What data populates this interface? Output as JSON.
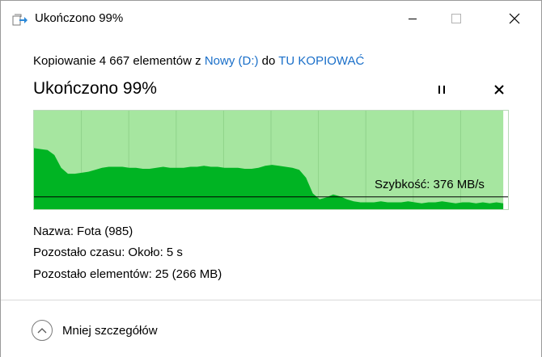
{
  "window": {
    "title": "Ukończono 99%"
  },
  "header": {
    "prefix": "Kopiowanie 4 667 elementów z",
    "source": "Nowy (D:)",
    "connector": "do",
    "destination": "TU KOPIOWAĆ"
  },
  "progress": {
    "title": "Ukończono 99%",
    "percent": 99
  },
  "graph": {
    "speed_label": "Szybkość: 376 MB/s",
    "current_speed_mb_s": 376,
    "colors": {
      "remaining": "#a6e6a0",
      "fill": "#00b423",
      "grid": "#8fd38a",
      "line": "#000000"
    },
    "throughput_profile": [
      0.62,
      0.61,
      0.6,
      0.55,
      0.42,
      0.36,
      0.36,
      0.37,
      0.38,
      0.4,
      0.42,
      0.43,
      0.43,
      0.43,
      0.42,
      0.42,
      0.41,
      0.41,
      0.42,
      0.43,
      0.42,
      0.42,
      0.42,
      0.43,
      0.43,
      0.44,
      0.43,
      0.43,
      0.42,
      0.42,
      0.42,
      0.41,
      0.41,
      0.42,
      0.44,
      0.45,
      0.44,
      0.43,
      0.42,
      0.4,
      0.32,
      0.16,
      0.1,
      0.12,
      0.15,
      0.13,
      0.1,
      0.08,
      0.07,
      0.07,
      0.07,
      0.08,
      0.07,
      0.07,
      0.07,
      0.08,
      0.07,
      0.06,
      0.07,
      0.07,
      0.08,
      0.07,
      0.06,
      0.07,
      0.07,
      0.06,
      0.07,
      0.06,
      0.07,
      0.06
    ]
  },
  "details": {
    "name_label": "Nazwa:",
    "name_value": "Fota (985)",
    "time_label": "Pozostało czasu:",
    "time_value": "Około: 5 s",
    "items_label": "Pozostało elementów:",
    "items_value": "25 (266 MB)"
  },
  "footer": {
    "less_details": "Mniej szczegółów"
  },
  "icons": {
    "app": "copy-arrow-icon",
    "pause": "pause-icon",
    "cancel": "close-icon",
    "chevron": "chevron-up-icon"
  }
}
